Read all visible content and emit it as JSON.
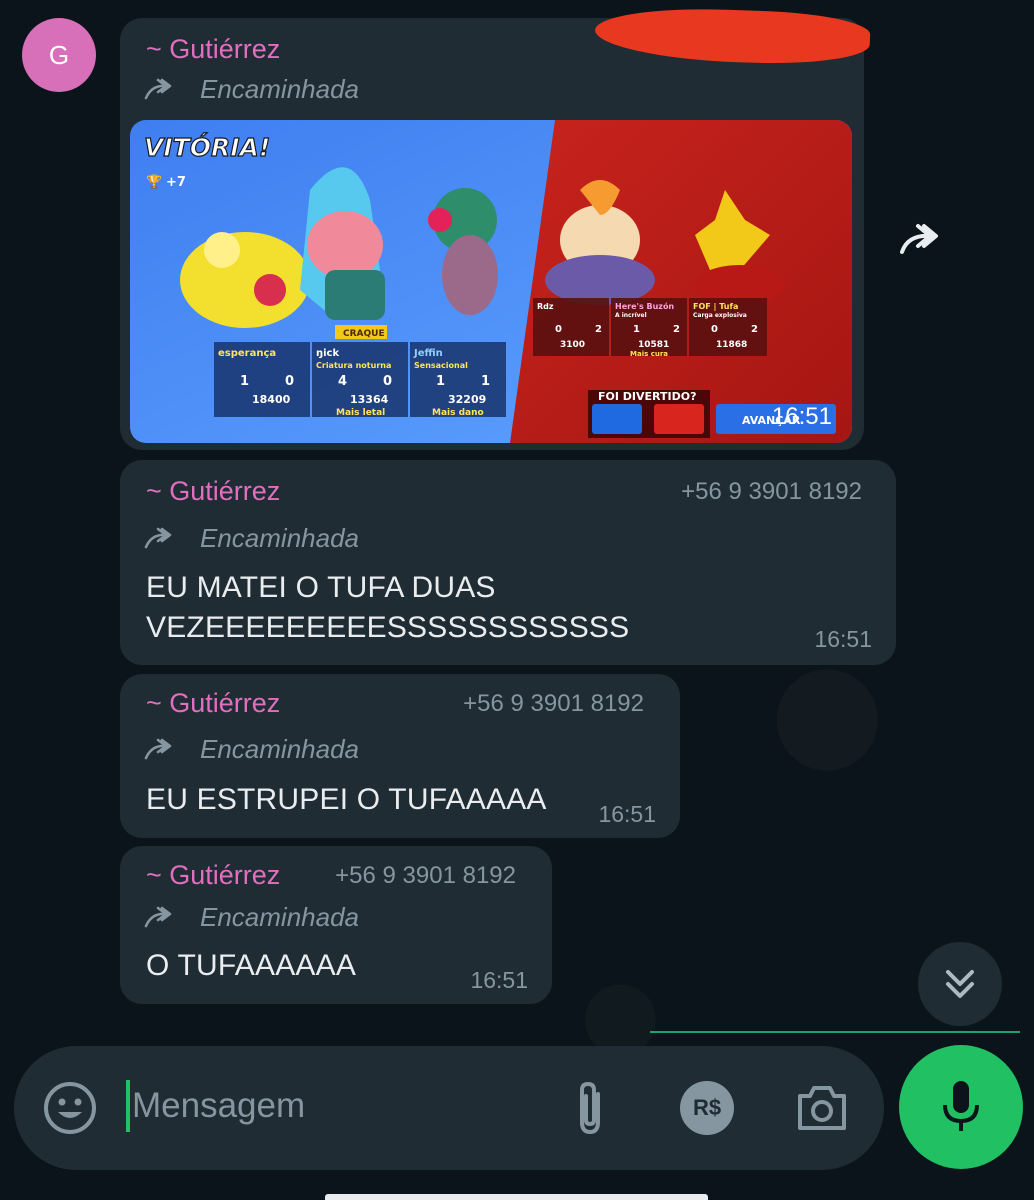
{
  "avatar": {
    "letter": "G",
    "color": "#d86fb9"
  },
  "accent": {
    "sender": "#e06fc0",
    "green": "#21c063"
  },
  "messages": [
    {
      "sender": "~ Gutiérrez",
      "phone": "",
      "forwarded": "Encaminhada",
      "time": "16:51",
      "kind": "image",
      "image": {
        "banner": "VITÓRIA!",
        "trophies": "+7",
        "players_left": [
          {
            "name": "esperança",
            "tag": "",
            "kills": "1",
            "deaths": "0",
            "score": "18400"
          },
          {
            "name": "ŋick",
            "tag": "Criatura noturna",
            "kills": "4",
            "deaths": "0",
            "score": "13364",
            "badge": "Mais letal"
          },
          {
            "name": "Jeffin",
            "tag": "Sensacional",
            "kills": "1",
            "deaths": "1",
            "score": "32209",
            "badge": "Mais dano"
          }
        ],
        "players_right": [
          {
            "name": "Rdz",
            "tag": "",
            "kills": "0",
            "deaths": "2",
            "score": "3100"
          },
          {
            "name": "Here's Buzón",
            "tag": "A incrível",
            "kills": "1",
            "deaths": "2",
            "score": "10581",
            "badge": "Mais cura"
          },
          {
            "name": "FOF | Tufa",
            "tag": "Carga explosiva",
            "kills": "0",
            "deaths": "2",
            "score": "11868"
          }
        ],
        "craque": "CRAQUE",
        "question": "FOI DIVERTIDO?",
        "advance": "AVANÇAR"
      }
    },
    {
      "sender": "~ Gutiérrez",
      "phone": "+56 9 3901 8192",
      "forwarded": "Encaminhada",
      "text_lines": [
        "EU MATEI O TUFA DUAS",
        "VEZEEEEEEEEESSSSSSSSSSSS"
      ],
      "time": "16:51"
    },
    {
      "sender": "~ Gutiérrez",
      "phone": "+56 9 3901 8192",
      "forwarded": "Encaminhada",
      "text_lines": [
        "EU ESTRUPEI O TUFAAAAA"
      ],
      "time": "16:51"
    },
    {
      "sender": "~ Gutiérrez",
      "phone": "+56 9 3901 8192",
      "forwarded": "Encaminhada",
      "text_lines": [
        "O TUFAAAAAA"
      ],
      "time": "16:51"
    }
  ],
  "composer": {
    "placeholder": "Mensagem",
    "icons": [
      "emoji-icon",
      "attach-icon",
      "payment-icon",
      "camera-icon",
      "mic-icon"
    ],
    "payment_label": "R$"
  }
}
